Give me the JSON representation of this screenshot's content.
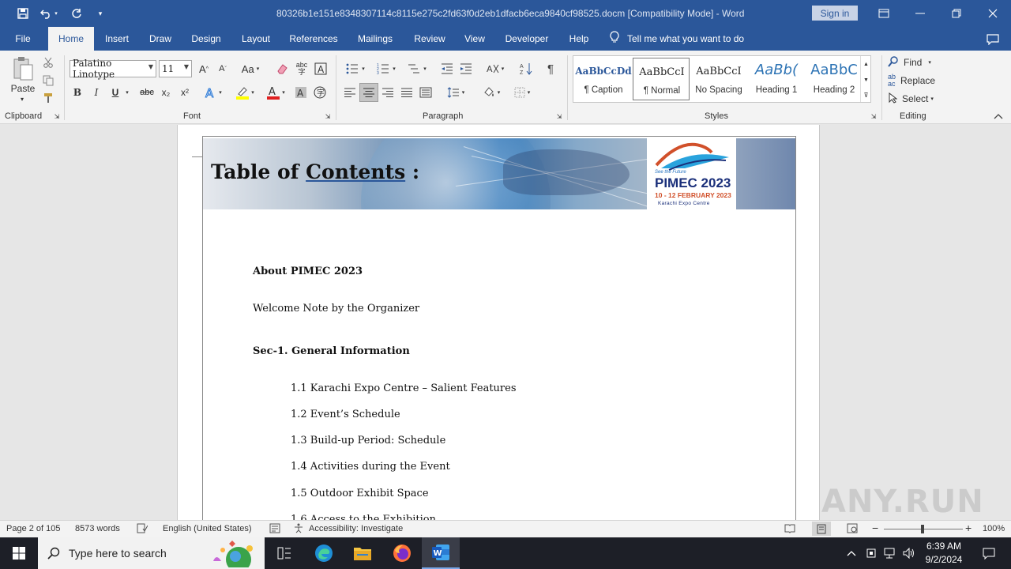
{
  "app": {
    "document_title": "80326b1e151e8348307114c8115e275c2fd63f0d2eb1dfacb6eca9840cf98525.docm [Compatibility Mode]  -  Word",
    "sign_in": "Sign in"
  },
  "tabs": [
    "File",
    "Home",
    "Insert",
    "Draw",
    "Design",
    "Layout",
    "References",
    "Mailings",
    "Review",
    "View",
    "Developer",
    "Help"
  ],
  "tell_me": "Tell me what you want to do",
  "ribbon": {
    "clipboard": {
      "paste": "Paste",
      "label": "Clipboard"
    },
    "font": {
      "name": "Palatino Linotype",
      "size": "11",
      "label": "Font",
      "case": "Aa",
      "bold": "B",
      "italic": "I",
      "underline": "U",
      "strike": "abc",
      "sub": "x₂",
      "sup": "x²",
      "grow": "A",
      "shrink": "A"
    },
    "paragraph": {
      "label": "Paragraph"
    },
    "styles": {
      "label": "Styles",
      "items": [
        {
          "preview": "AaBbCcDd",
          "name": "¶ Caption"
        },
        {
          "preview": "AaBbCcI",
          "name": "¶ Normal"
        },
        {
          "preview": "AaBbCcI",
          "name": "No Spacing"
        },
        {
          "preview": "AaBb(",
          "name": "Heading 1"
        },
        {
          "preview": "AaBbC",
          "name": "Heading 2"
        }
      ]
    },
    "editing": {
      "find": "Find",
      "replace": "Replace",
      "select": "Select",
      "label": "Editing"
    }
  },
  "document": {
    "banner_title_prefix": "Table of ",
    "banner_title_underlined": "Contents",
    "banner_title_suffix": " :",
    "logo": {
      "tagline": "See the Future",
      "name": "PIMEC 2023",
      "dates": "10 - 12 FEBRUARY 2023",
      "venue": "Karachi Expo Centre"
    },
    "toc": [
      {
        "text": "About PIMEC 2023",
        "bold": true
      },
      {
        "text": "Welcome Note by the Organizer",
        "bold": false
      },
      {
        "text": "Sec-1.  General Information",
        "bold": true
      },
      {
        "text": "1.1 Karachi Expo Centre – Salient Features",
        "bold": false
      },
      {
        "text": "1.2 Event’s Schedule",
        "bold": false
      },
      {
        "text": "1.3 Build-up Period: Schedule",
        "bold": false
      },
      {
        "text": "1.4 Activities during the Event",
        "bold": false
      },
      {
        "text": "1.5 Outdoor Exhibit Space",
        "bold": false
      },
      {
        "text": "1.6 Access to the Exhibition",
        "bold": false
      }
    ]
  },
  "status": {
    "page": "Page 2 of 105",
    "words": "8573 words",
    "language": "English (United States)",
    "accessibility": "Accessibility: Investigate",
    "zoom": "100%",
    "zoom_level": 1.0
  },
  "taskbar": {
    "search_placeholder": "Type here to search",
    "time": "6:39 AM",
    "date": "9/2/2024"
  },
  "watermark": "ANY.RUN",
  "colors": {
    "word_blue": "#2b579a",
    "ribbon_bg": "#f3f3f3",
    "taskbar_bg": "#1d1f27"
  }
}
